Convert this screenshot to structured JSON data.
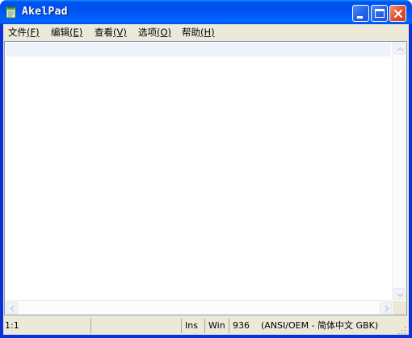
{
  "window": {
    "title": "AkelPad"
  },
  "menu": {
    "items": [
      {
        "label": "文件",
        "accel": "(F)"
      },
      {
        "label": "编辑",
        "accel": "(E)"
      },
      {
        "label": "查看",
        "accel": "(V)"
      },
      {
        "label": "选项",
        "accel": "(O)"
      },
      {
        "label": "帮助",
        "accel": "(H)"
      }
    ]
  },
  "editor": {
    "content": ""
  },
  "status": {
    "position": "1:1",
    "modified": "",
    "insert_mode": "Ins",
    "newline": "Win",
    "codepage": "936",
    "encoding": "(ANSI/OEM - 简体中文 GBK)"
  },
  "icons": {
    "app": "notepad-icon",
    "minimize": "minimize-icon",
    "maximize": "maximize-icon",
    "close": "close-icon",
    "scroll_up": "arrow-up-icon",
    "scroll_down": "arrow-down-icon",
    "scroll_left": "arrow-left-icon",
    "scroll_right": "arrow-right-icon",
    "size_grip": "size-grip-icon"
  },
  "colors": {
    "titlebar": "#0058ee",
    "frame": "#0831d9",
    "chrome": "#ece9d8",
    "current_line": "#eef3fa",
    "close_button": "#e0502a"
  }
}
